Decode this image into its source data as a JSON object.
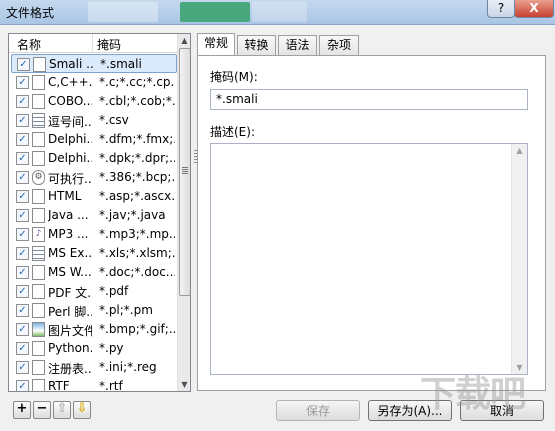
{
  "window": {
    "title": "文件格式",
    "help_label": "?",
    "close_label": "X"
  },
  "list": {
    "columns": [
      "名称",
      "掩码"
    ],
    "rows": [
      {
        "name": "Smali ...",
        "ext": "*.smali",
        "icon": "file-icon",
        "checked": true,
        "selected": true
      },
      {
        "name": "C,C++...",
        "ext": "*.c;*.cc;*.cp...",
        "icon": "file-icon",
        "checked": true
      },
      {
        "name": "COBO...",
        "ext": "*.cbl;*.cob;*...",
        "icon": "file-icon",
        "checked": true
      },
      {
        "name": "逗号间...",
        "ext": "*.csv",
        "icon": "grid-icon",
        "checked": true
      },
      {
        "name": "Delphi...",
        "ext": "*.dfm;*.fmx;...",
        "icon": "file-icon",
        "checked": true
      },
      {
        "name": "Delphi...",
        "ext": "*.dpk;*.dpr;...",
        "icon": "file-icon",
        "checked": true
      },
      {
        "name": "可执行...",
        "ext": "*.386;*.bcp;...",
        "icon": "gear-icon",
        "checked": true
      },
      {
        "name": "HTML",
        "ext": "*.asp;*.ascx...",
        "icon": "file-icon",
        "checked": true
      },
      {
        "name": "Java ...",
        "ext": "*.jav;*.java",
        "icon": "file-icon",
        "checked": true
      },
      {
        "name": "MP3 ...",
        "ext": "*.mp3;*.mp...",
        "icon": "music-icon",
        "checked": true
      },
      {
        "name": "MS Ex...",
        "ext": "*.xls;*.xlsm;...",
        "icon": "grid-icon",
        "checked": true
      },
      {
        "name": "MS W...",
        "ext": "*.doc;*.doc...",
        "icon": "file-icon",
        "checked": true
      },
      {
        "name": "PDF 文...",
        "ext": "*.pdf",
        "icon": "file-icon",
        "checked": true
      },
      {
        "name": "Perl 脚...",
        "ext": "*.pl;*.pm",
        "icon": "file-icon",
        "checked": true
      },
      {
        "name": "图片文件",
        "ext": "*.bmp;*.gif;...",
        "icon": "image-icon",
        "checked": true
      },
      {
        "name": "Python...",
        "ext": "*.py",
        "icon": "file-icon",
        "checked": true
      },
      {
        "name": "注册表...",
        "ext": "*.ini;*.reg",
        "icon": "file-icon",
        "checked": true
      },
      {
        "name": "RTF",
        "ext": "*.rtf",
        "icon": "file-icon",
        "checked": true
      }
    ]
  },
  "list_buttons": {
    "add": "+",
    "remove": "−",
    "up": "⇧",
    "down": "⇩"
  },
  "tabs": [
    "常规",
    "转换",
    "语法",
    "杂项"
  ],
  "general": {
    "mask_label": "掩码(M):",
    "mask_value": "*.smali",
    "desc_label": "描述(E):",
    "desc_value": ""
  },
  "buttons": {
    "save": "保存",
    "save_as": "另存为(A)...",
    "cancel": "取消"
  },
  "watermark": "下载吧"
}
